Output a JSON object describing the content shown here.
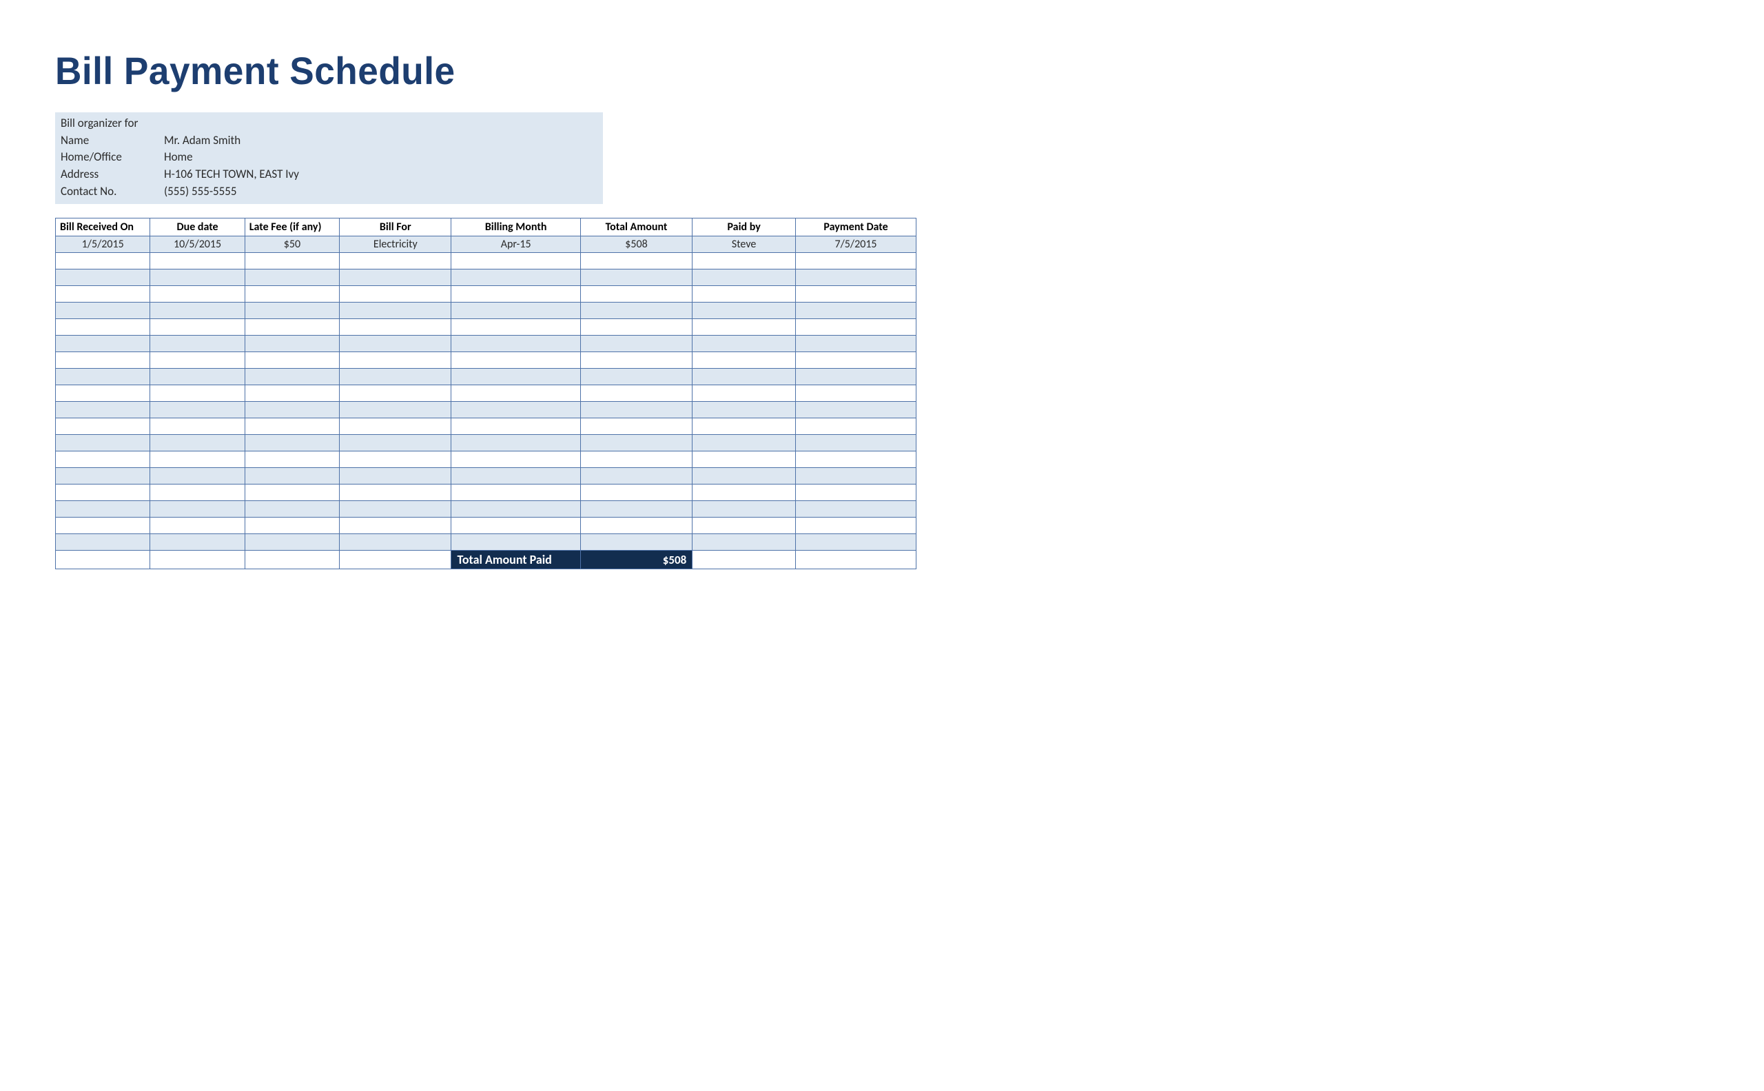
{
  "title": "Bill Payment Schedule",
  "info": {
    "heading": "Bill organizer for",
    "rows": [
      {
        "label": "Name",
        "value": "Mr. Adam Smith"
      },
      {
        "label": "Home/Office",
        "value": "Home"
      },
      {
        "label": "Address",
        "value": "H-106 TECH TOWN, EAST Ivy"
      },
      {
        "label": "Contact No.",
        "value": "(555) 555-5555"
      }
    ]
  },
  "table": {
    "headers": [
      "Bill Received On",
      "Due date",
      "Late Fee (if any)",
      "Bill For",
      "Billing Month",
      "Total Amount",
      "Paid by",
      "Payment Date"
    ],
    "rows": [
      [
        "1/5/2015",
        "10/5/2015",
        "$50",
        "Electricity",
        "Apr-15",
        "$508",
        "Steve",
        "7/5/2015"
      ],
      [
        "",
        "",
        "",
        "",
        "",
        "",
        "",
        ""
      ],
      [
        "",
        "",
        "",
        "",
        "",
        "",
        "",
        ""
      ],
      [
        "",
        "",
        "",
        "",
        "",
        "",
        "",
        ""
      ],
      [
        "",
        "",
        "",
        "",
        "",
        "",
        "",
        ""
      ],
      [
        "",
        "",
        "",
        "",
        "",
        "",
        "",
        ""
      ],
      [
        "",
        "",
        "",
        "",
        "",
        "",
        "",
        ""
      ],
      [
        "",
        "",
        "",
        "",
        "",
        "",
        "",
        ""
      ],
      [
        "",
        "",
        "",
        "",
        "",
        "",
        "",
        ""
      ],
      [
        "",
        "",
        "",
        "",
        "",
        "",
        "",
        ""
      ],
      [
        "",
        "",
        "",
        "",
        "",
        "",
        "",
        ""
      ],
      [
        "",
        "",
        "",
        "",
        "",
        "",
        "",
        ""
      ],
      [
        "",
        "",
        "",
        "",
        "",
        "",
        "",
        ""
      ],
      [
        "",
        "",
        "",
        "",
        "",
        "",
        "",
        ""
      ],
      [
        "",
        "",
        "",
        "",
        "",
        "",
        "",
        ""
      ],
      [
        "",
        "",
        "",
        "",
        "",
        "",
        "",
        ""
      ],
      [
        "",
        "",
        "",
        "",
        "",
        "",
        "",
        ""
      ],
      [
        "",
        "",
        "",
        "",
        "",
        "",
        "",
        ""
      ],
      [
        "",
        "",
        "",
        "",
        "",
        "",
        "",
        ""
      ]
    ],
    "total_label": "Total Amount Paid",
    "total_value": "$508"
  }
}
